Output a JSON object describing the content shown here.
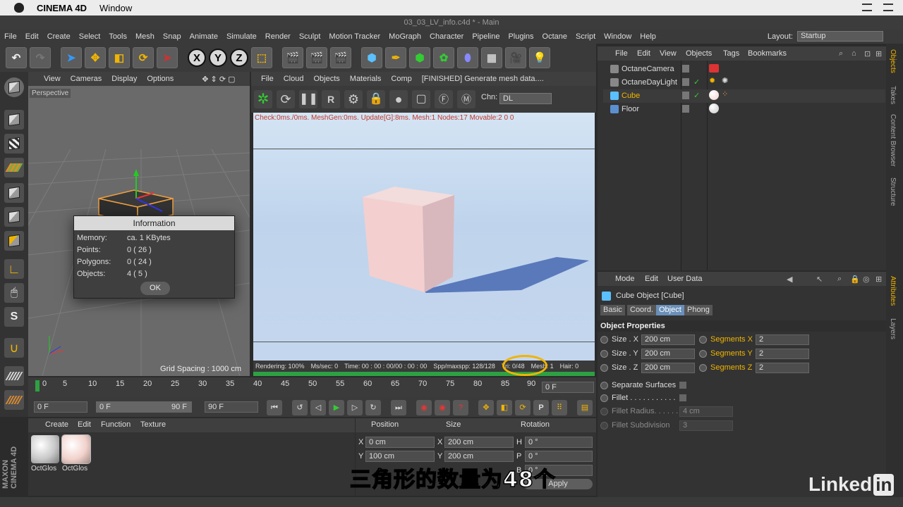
{
  "mac": {
    "app_name": "CINEMA 4D",
    "menu_window": "Window"
  },
  "window_title": "03_03_LV_info.c4d * - Main",
  "menu": [
    "File",
    "Edit",
    "Create",
    "Select",
    "Tools",
    "Mesh",
    "Snap",
    "Animate",
    "Simulate",
    "Render",
    "Sculpt",
    "Motion Tracker",
    "MoGraph",
    "Character",
    "Pipeline",
    "Plugins",
    "Octane",
    "Script",
    "Window",
    "Help"
  ],
  "layout": {
    "label": "Layout:",
    "value": "Startup"
  },
  "toolbar": {
    "x": "X",
    "y": "Y",
    "z": "Z"
  },
  "viewport": {
    "menu": [
      "View",
      "Cameras",
      "Display",
      "Options"
    ],
    "label": "Perspective",
    "grid_spacing": "Grid Spacing : 1000 cm"
  },
  "info_dialog": {
    "title": "Information",
    "rows": [
      {
        "k": "Memory:",
        "v": "ca. 1 KBytes"
      },
      {
        "k": "Points:",
        "v": "0 ( 26 )"
      },
      {
        "k": "Polygons:",
        "v": "0 ( 24 )"
      },
      {
        "k": "Objects:",
        "v": "4 ( 5 )"
      }
    ],
    "ok": "OK"
  },
  "octane": {
    "menu": [
      "File",
      "Cloud",
      "Objects",
      "Materials",
      "Comp"
    ],
    "status_msg": "[FINISHED] Generate mesh data....",
    "chn_label": "Chn:",
    "chn_value": "DL",
    "stats_line": "Check:0ms./0ms. MeshGen:0ms. Update[G]:8ms. Mesh:1 Nodes:17 Movable:2  0 0",
    "status": [
      "Rendering: 100%",
      "Ms/sec: 0",
      "Time: 00 : 00 : 00/00 : 00 : 00",
      "Spp/maxspp: 128/128",
      "Tri: 0/48",
      "Mesh: 1",
      "Hair: 0"
    ]
  },
  "timeline": {
    "ticks": [
      "0",
      "5",
      "10",
      "15",
      "20",
      "25",
      "30",
      "35",
      "40",
      "45",
      "50",
      "55",
      "60",
      "65",
      "70",
      "75",
      "80",
      "85",
      "90"
    ],
    "current": "0 F"
  },
  "playbar": {
    "start": "0 F",
    "range_start": "0 F",
    "range_end": "90 F",
    "end": "90 F"
  },
  "materials": {
    "menu": [
      "Create",
      "Edit",
      "Function",
      "Texture"
    ],
    "items": [
      "OctGlos",
      "OctGlos"
    ]
  },
  "coords": {
    "headers": [
      "Position",
      "Size",
      "Rotation"
    ],
    "rows": [
      {
        "a": "X",
        "pos": "0 cm",
        "b": "X",
        "size": "200 cm",
        "c": "H",
        "rot": "0 °"
      },
      {
        "a": "Y",
        "pos": "100 cm",
        "b": "Y",
        "size": "200 cm",
        "c": "P",
        "rot": "0 °"
      },
      {
        "a": "Z",
        "pos": "",
        "b": "Z",
        "size": "",
        "c": "B",
        "rot": "0 °"
      }
    ],
    "apply": "Apply"
  },
  "objects": {
    "menu": [
      "File",
      "Edit",
      "View",
      "Objects",
      "Tags",
      "Bookmarks"
    ],
    "items": [
      "OctaneCamera",
      "OctaneDayLight",
      "Cube",
      "Floor"
    ]
  },
  "attributes": {
    "menu": [
      "Mode",
      "Edit",
      "User Data"
    ],
    "object_title": "Cube Object [Cube]",
    "tabs": [
      "Basic",
      "Coord.",
      "Object",
      "Phong"
    ],
    "section": "Object Properties",
    "size_x": {
      "label": "Size . X",
      "value": "200 cm"
    },
    "size_y": {
      "label": "Size . Y",
      "value": "200 cm"
    },
    "size_z": {
      "label": "Size . Z",
      "value": "200 cm"
    },
    "seg_x": {
      "label": "Segments X",
      "value": "2"
    },
    "seg_y": {
      "label": "Segments Y",
      "value": "2"
    },
    "seg_z": {
      "label": "Segments Z",
      "value": "2"
    },
    "separate": "Separate Surfaces",
    "fillet": "Fillet . . . . . . . . . . .",
    "fillet_radius": {
      "label": "Fillet Radius. . . . . .",
      "value": "4 cm"
    },
    "fillet_sub": {
      "label": "Fillet Subdivision",
      "value": "3"
    }
  },
  "side_tabs": [
    "Objects",
    "Takes",
    "Content Browser",
    "Structure",
    "Attributes",
    "Layers"
  ],
  "maxon": "MAXON CINEMA 4D",
  "subtitle": "三角形的数量为48个",
  "watermark": {
    "text": "Linked",
    "in": "in"
  },
  "colors": {
    "accent": "#f0b400",
    "active_tab": "#6a8fb8",
    "progress": "#2ea043",
    "stats_text": "#c0392b"
  }
}
